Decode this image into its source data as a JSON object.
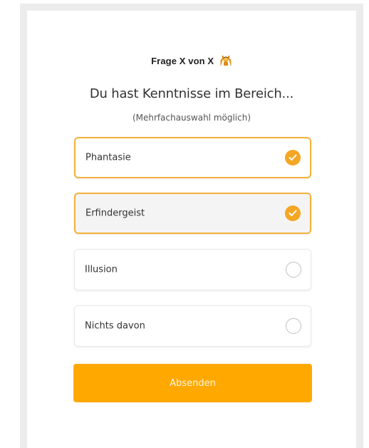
{
  "header": {
    "counter": "Frage X von X",
    "emoji": "person-gesturing-icon"
  },
  "question": {
    "title": "Du hast Kenntnisse im Bereich...",
    "hint": "(Mehrfachauswahl möglich)"
  },
  "options": [
    {
      "label": "Phantasie",
      "selected": true
    },
    {
      "label": "Erfindergeist",
      "selected": true
    },
    {
      "label": "Illusion",
      "selected": false
    },
    {
      "label": "Nichts davon",
      "selected": false
    }
  ],
  "submit": {
    "label": "Absenden"
  },
  "colors": {
    "accent": "#ffa800",
    "selected_border": "#f5b13a",
    "check_fill": "#f5a623"
  }
}
